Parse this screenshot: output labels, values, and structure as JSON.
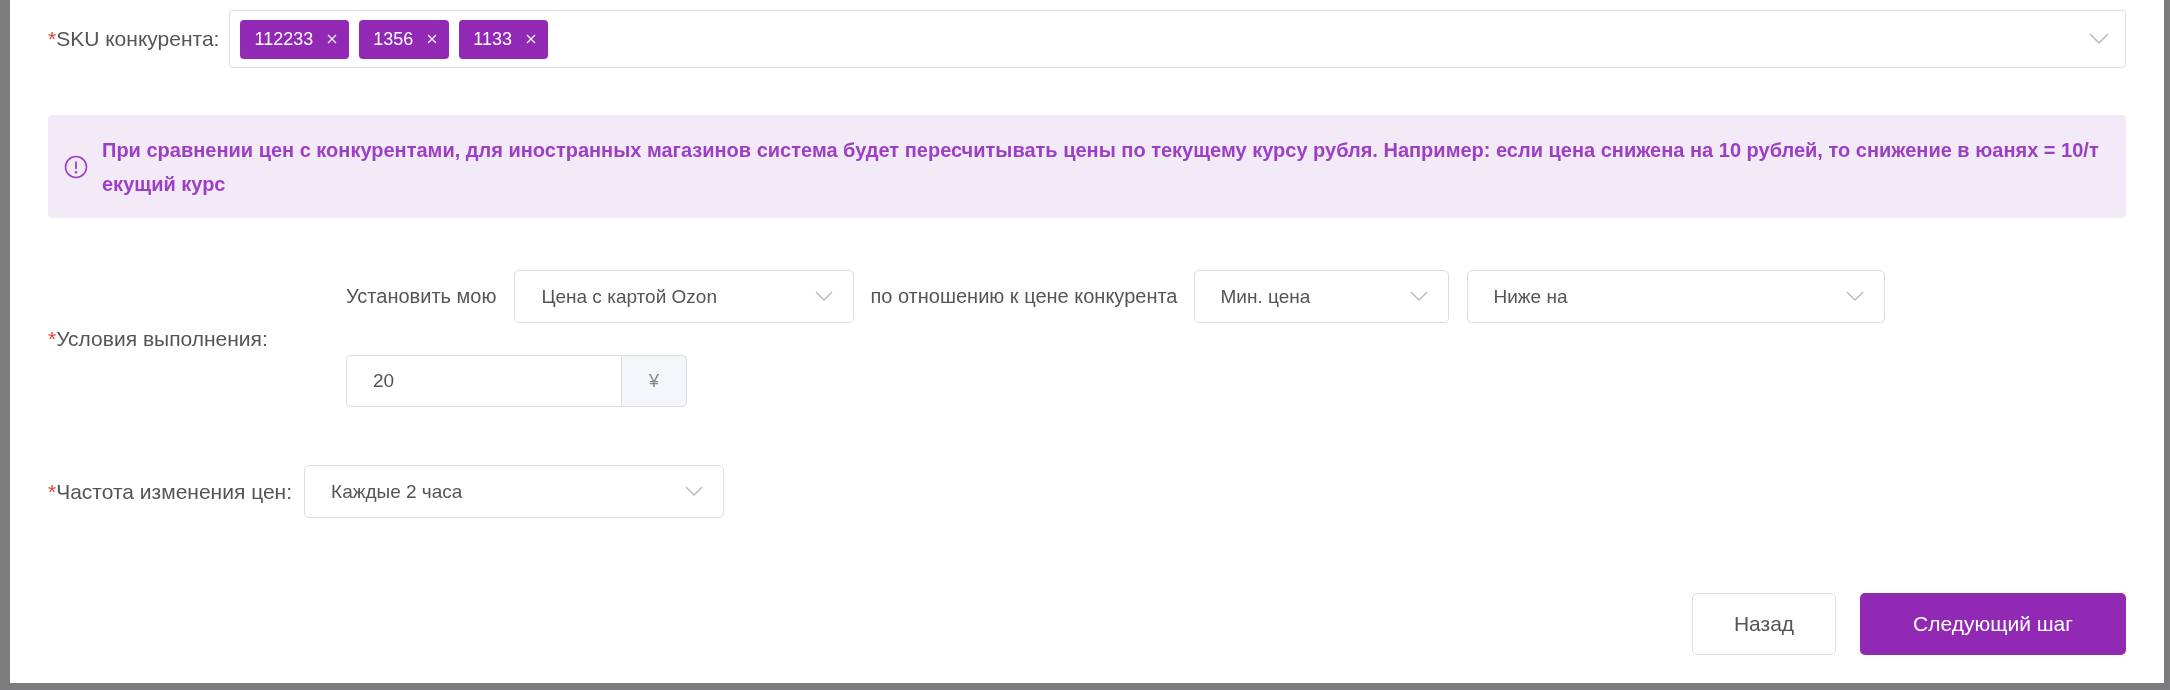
{
  "form": {
    "sku": {
      "mark": "*",
      "label": "SKU конкурента:",
      "tags": [
        "112233",
        "1356",
        "1133"
      ]
    },
    "notice": "При сравнении цен с конкурентами, для иностранных магазинов система будет пересчитывать цены по текущему курсу рубля. Например: если цена снижена на 10 рублей, то снижение в юанях = 10/текущий курс",
    "conditions": {
      "mark": "*",
      "label": "Условия выполнения:",
      "prefix": "Установить мою",
      "price_type": "Цена с картой Ozon",
      "middle": "по отношению к цене конкурента",
      "competitor_price": "Мин. цена",
      "direction": "Ниже на",
      "amount": "20",
      "unit": "¥"
    },
    "frequency": {
      "mark": "*",
      "label": "Частота изменения цен:",
      "value": "Каждые 2 часа"
    }
  },
  "buttons": [
    {
      "label": "Назад",
      "kind": "secondary"
    },
    {
      "label": "Следующий шаг",
      "kind": "primary"
    }
  ]
}
